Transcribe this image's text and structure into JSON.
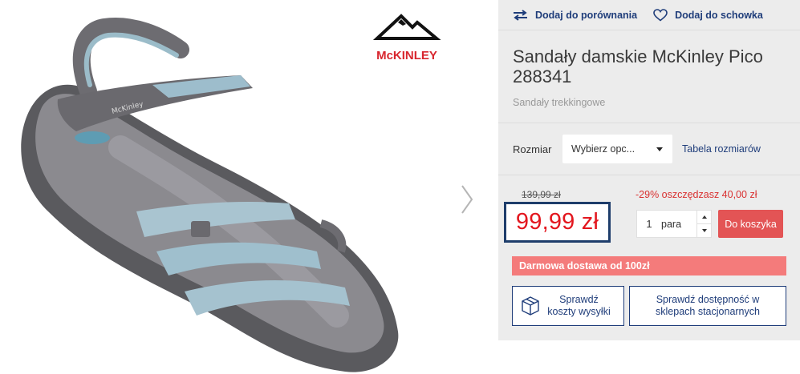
{
  "gallery": {
    "brand_logo_text": "McKINLEY",
    "next_icon": "chevron-right-icon",
    "image_subject": "sandal"
  },
  "actions": {
    "compare_label": "Dodaj do porównania",
    "compare_icon": "compare-arrows-icon",
    "wishlist_label": "Dodaj do schowka",
    "wishlist_icon": "heart-icon"
  },
  "product": {
    "title": "Sandały damskie McKinley Pico 288341",
    "category": "Sandały trekkingowe"
  },
  "size": {
    "label": "Rozmiar",
    "select_value": "Wybierz opc...",
    "table_link": "Tabela rozmiarów"
  },
  "price": {
    "old": "139,99 zł",
    "discount": "-29% oszczędzasz 40,00 zł",
    "current": "99,99 zł"
  },
  "quantity": {
    "value": "1",
    "unit": "para"
  },
  "cart": {
    "add_label": "Do koszyka"
  },
  "delivery": {
    "banner": "Darmowa dostawa od 100zł"
  },
  "buttons": {
    "shipping_line1": "Sprawdź",
    "shipping_line2": "koszty wysyłki",
    "shipping_icon": "package-icon",
    "stock_line1": "Sprawdź dostępność w",
    "stock_line2": "sklepach stacjonarnych"
  },
  "colors": {
    "brand_blue": "#1f3d7a",
    "price_red": "#e3161e",
    "cart_red": "#e35455",
    "banner_red": "#f47b7b",
    "panel_bg": "#ececec"
  }
}
